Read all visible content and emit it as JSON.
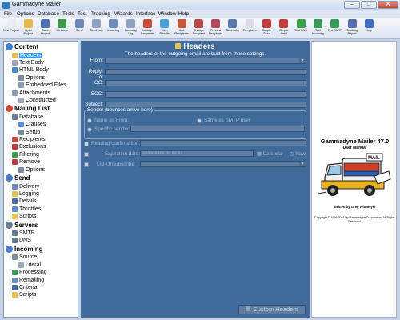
{
  "window": {
    "title": "Gammadyne Mailer",
    "min": "–",
    "max": "□",
    "close": "✕"
  },
  "menu": [
    "File",
    "Options",
    "Database",
    "Tools",
    "Test",
    "Tracking",
    "Wizards",
    "Interface",
    "Window",
    "Help"
  ],
  "toolbar": [
    {
      "label": "New Project",
      "icon": "new-project-icon",
      "color": "#e9eef6"
    },
    {
      "label": "Open Project",
      "icon": "open-folder-icon",
      "color": "#e7b94a"
    },
    {
      "label": "Save Project",
      "icon": "save-icon",
      "color": "#4a6fb2"
    },
    {
      "label": "Welcome",
      "icon": "welcome-icon",
      "color": "#3f9a4a"
    },
    {
      "label": "Send",
      "icon": "send-icon",
      "color": "#6f87b6"
    },
    {
      "label": "Send Log",
      "icon": "send-log-icon",
      "color": "#8fa2c4"
    },
    {
      "label": "Incoming",
      "icon": "incoming-icon",
      "color": "#6c8dc0"
    },
    {
      "label": "Incoming Log",
      "icon": "incoming-log-icon",
      "color": "#8fa2c4"
    },
    {
      "label": "Lookup Recipients",
      "icon": "lookup-icon",
      "color": "#c94a3c"
    },
    {
      "label": "View Results",
      "icon": "results-icon",
      "color": "#4aa0d8"
    },
    {
      "label": "Add Recipients",
      "icon": "add-recipients-icon",
      "color": "#c45a3c"
    },
    {
      "label": "Change Recipient",
      "icon": "change-recipient-icon",
      "color": "#b84a4a"
    },
    {
      "label": "Preview Recipients",
      "icon": "preview-icon",
      "color": "#b44a5a"
    },
    {
      "label": "Scheduler",
      "icon": "scheduler-icon",
      "color": "#5a7ab0"
    },
    {
      "label": "Templates",
      "icon": "templates-icon",
      "color": "#d8dde6"
    },
    {
      "label": "Simple Send",
      "icon": "simple-send-icon",
      "color": "#c43c3c"
    },
    {
      "label": "Simple Send",
      "icon": "simple-send-2-icon",
      "color": "#c43c3c"
    },
    {
      "label": "Test DNS",
      "icon": "test-dns-icon",
      "color": "#3aa04a"
    },
    {
      "label": "Test Incoming",
      "icon": "test-incoming-icon",
      "color": "#3a9a5a"
    },
    {
      "label": "Test SMTP",
      "icon": "test-smtp-icon",
      "color": "#3a9a5a"
    },
    {
      "label": "Tracking Report",
      "icon": "tracking-icon",
      "color": "#5a6fb0"
    },
    {
      "label": "Help",
      "icon": "help-icon",
      "color": "#3a6fc4"
    }
  ],
  "tree": [
    {
      "label": "Content",
      "level": 0,
      "section": true,
      "icon": "content-icon",
      "color": "#3a7fd0"
    },
    {
      "label": "Headers",
      "level": 1,
      "selected": true,
      "icon": "headers-icon",
      "color": "#e8c24a"
    },
    {
      "label": "Text Body",
      "level": 1,
      "icon": "text-body-icon",
      "color": "#9aa8ba"
    },
    {
      "label": "HTML Body",
      "level": 1,
      "icon": "html-body-icon",
      "color": "#4a8ad8"
    },
    {
      "label": "Options",
      "level": 2,
      "icon": "options-icon",
      "color": "#7a8aa0"
    },
    {
      "label": "Embedded Files",
      "level": 2,
      "icon": "embedded-files-icon",
      "color": "#8a9ab0"
    },
    {
      "label": "Attachments",
      "level": 1,
      "icon": "attachments-icon",
      "color": "#8a9ab0"
    },
    {
      "label": "Constructed",
      "level": 2,
      "icon": "constructed-icon",
      "color": "#a0aabb"
    },
    {
      "label": "Mailing List",
      "level": 0,
      "section": true,
      "icon": "mailing-list-icon",
      "color": "#d04a3a"
    },
    {
      "label": "Database",
      "level": 1,
      "icon": "database-icon",
      "color": "#6a7a90"
    },
    {
      "label": "Clauses",
      "level": 2,
      "icon": "clauses-icon",
      "color": "#5a8ad0"
    },
    {
      "label": "Setup",
      "level": 2,
      "icon": "setup-icon",
      "color": "#7a8aa0"
    },
    {
      "label": "Recipients",
      "level": 1,
      "icon": "recipients-icon",
      "color": "#c44a3a"
    },
    {
      "label": "Exclusions",
      "level": 1,
      "icon": "exclusions-icon",
      "color": "#c43a3a"
    },
    {
      "label": "Filtering",
      "level": 1,
      "icon": "filtering-icon",
      "color": "#3a9a4a"
    },
    {
      "label": "Remove",
      "level": 1,
      "icon": "remove-icon",
      "color": "#c43a3a"
    },
    {
      "label": "Options",
      "level": 2,
      "icon": "options-icon",
      "color": "#7a8aa0"
    },
    {
      "label": "Send",
      "level": 0,
      "section": true,
      "icon": "send-section-icon",
      "color": "#4a7ac8"
    },
    {
      "label": "Delivery",
      "level": 1,
      "icon": "delivery-icon",
      "color": "#6a8ac0"
    },
    {
      "label": "Logging",
      "level": 1,
      "icon": "logging-icon",
      "color": "#e8c24a"
    },
    {
      "label": "Details",
      "level": 1,
      "icon": "details-icon",
      "color": "#4a6aa0"
    },
    {
      "label": "Throttles",
      "level": 1,
      "icon": "throttles-icon",
      "color": "#5a8ad0"
    },
    {
      "label": "Scripts",
      "level": 1,
      "icon": "scripts-icon",
      "color": "#e8c24a"
    },
    {
      "label": "Servers",
      "level": 0,
      "section": true,
      "icon": "servers-icon",
      "color": "#6a7a90"
    },
    {
      "label": "SMTP",
      "level": 1,
      "icon": "smtp-icon",
      "color": "#6a7a90"
    },
    {
      "label": "DNS",
      "level": 1,
      "icon": "dns-icon",
      "color": "#6a7a90"
    },
    {
      "label": "Incoming",
      "level": 0,
      "section": true,
      "icon": "incoming-section-icon",
      "color": "#4a7ac8"
    },
    {
      "label": "Source",
      "level": 1,
      "icon": "source-icon",
      "color": "#7a8aa0"
    },
    {
      "label": "Literal",
      "level": 2,
      "icon": "literal-icon",
      "color": "#9aa8ba"
    },
    {
      "label": "Processing",
      "level": 1,
      "icon": "processing-icon",
      "color": "#3a9a4a"
    },
    {
      "label": "Remailing",
      "level": 1,
      "icon": "remailing-icon",
      "color": "#6a8ac0"
    },
    {
      "label": "Criteria",
      "level": 1,
      "icon": "criteria-icon",
      "color": "#4a6aa0"
    },
    {
      "label": "Scripts",
      "level": 1,
      "icon": "scripts-icon",
      "color": "#e8c24a"
    }
  ],
  "headers": {
    "title": "Headers",
    "subtitle": "The headers of the outgoing email are built from these settings.",
    "from_label": "From:",
    "reply_to_label": "Reply-To:",
    "cc_label": "CC:",
    "bcc_label": "BCC:",
    "subject_label": "Subject:",
    "from_value": "",
    "reply_to_value": "",
    "cc_value": "",
    "bcc_value": "",
    "subject_value": "",
    "sender_group": "Sender (bounces arrive here)",
    "same_as_from": "Same as From:",
    "same_as_smtp": "Same as SMTP user",
    "specific_sender": "Specific sender:",
    "reading_confirmation": "Reading confirmation:",
    "expiration_date": "Expiration date:",
    "expiration_placeholder": "##/##/#### ##:## ##",
    "calendar_btn": "Calendar",
    "now_btn": "Now",
    "list_unsubscribe": "List-Unsubscribe:",
    "custom_headers_btn": "Custom Headers"
  },
  "manual": {
    "title": "Gammadyne Mailer 47.0",
    "subtitle": "User Manual",
    "author": "Written by Greg Wittmeyer",
    "copyright": "Copyright © 1999-2015 by Gammadyne Corporation. All Rights Reserved."
  }
}
